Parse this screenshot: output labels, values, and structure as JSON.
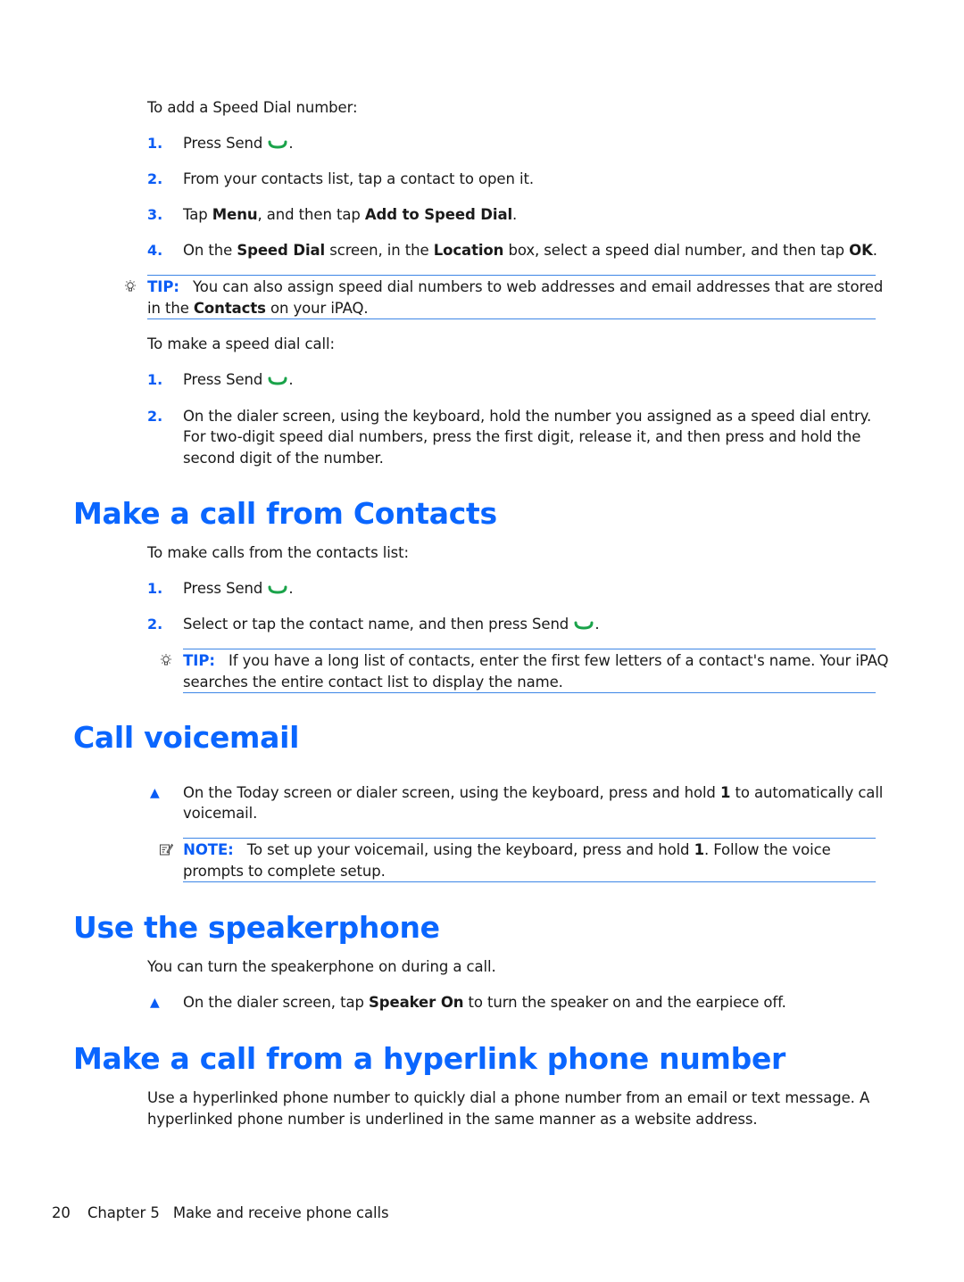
{
  "colors": {
    "heading": "#0a66ff",
    "accent": "#0a5cf5",
    "rule": "#3d86e6",
    "send_icon": "#1aa34a"
  },
  "speed_dial_add": {
    "intro": "To add a Speed Dial number:",
    "steps": [
      {
        "num": "1.",
        "pre": "Press Send",
        "post": "."
      },
      {
        "num": "2.",
        "text": "From your contacts list, tap a contact to open it."
      },
      {
        "num": "3.",
        "t1": "Tap ",
        "b1": "Menu",
        "t2": ", and then tap ",
        "b2": "Add to Speed Dial",
        "t3": "."
      },
      {
        "num": "4.",
        "t1": "On the ",
        "b1": "Speed Dial",
        "t2": " screen, in the ",
        "b2": "Location",
        "t3": " box, select a speed dial number, and then tap ",
        "b3": "OK",
        "t4": "."
      }
    ],
    "tip": {
      "label": "TIP:",
      "line1": "You can also assign speed dial numbers to web addresses and email addresses that are stored",
      "l2a": "in the ",
      "l2b": "Contacts",
      "l2c": " on your iPAQ."
    }
  },
  "speed_dial_call": {
    "intro": "To make a speed dial call:",
    "steps": [
      {
        "num": "1.",
        "pre": "Press Send",
        "post": "."
      },
      {
        "num": "2.",
        "line1": "On the dialer screen, using the keyboard, hold the number you assigned as a speed dial entry.",
        "line2": "For two-digit speed dial numbers, press the first digit, release it, and then press and hold the",
        "line3": "second digit of the number."
      }
    ]
  },
  "contacts": {
    "heading": "Make a call from Contacts",
    "intro": "To make calls from the contacts list:",
    "steps": [
      {
        "num": "1.",
        "pre": "Press Send",
        "post": "."
      },
      {
        "num": "2.",
        "pre": "Select or tap the contact name, and then press Send",
        "post": "."
      }
    ],
    "tip": {
      "label": "TIP:",
      "line1": "If you have a long list of contacts, enter the first few letters of a contact's name. Your iPAQ",
      "line2": "searches the entire contact list to display the name."
    }
  },
  "voicemail": {
    "heading": "Call voicemail",
    "bullet": {
      "l1a": "On the Today screen or dialer screen, using the keyboard, press and hold ",
      "l1b": "1",
      "l1c": " to automatically call",
      "line2": "voicemail."
    },
    "note": {
      "label": "NOTE:",
      "l1a": "To set up your voicemail, using the keyboard, press and hold ",
      "l1b": "1",
      "l1c": ". Follow the voice",
      "line2": "prompts to complete setup."
    }
  },
  "speakerphone": {
    "heading": "Use the speakerphone",
    "intro": "You can turn the speakerphone on during a call.",
    "bullet": {
      "t1": "On the dialer screen, tap ",
      "b1": "Speaker On",
      "t2": " to turn the speaker on and the earpiece off."
    }
  },
  "hyperlink": {
    "heading": "Make a call from a hyperlink phone number",
    "line1": "Use a hyperlinked phone number to quickly dial a phone number from an email or text message. A",
    "line2": "hyperlinked phone number is underlined in the same manner as a website address."
  },
  "footer": {
    "page": "20",
    "chapter": "Chapter 5",
    "title": "Make and receive phone calls"
  }
}
